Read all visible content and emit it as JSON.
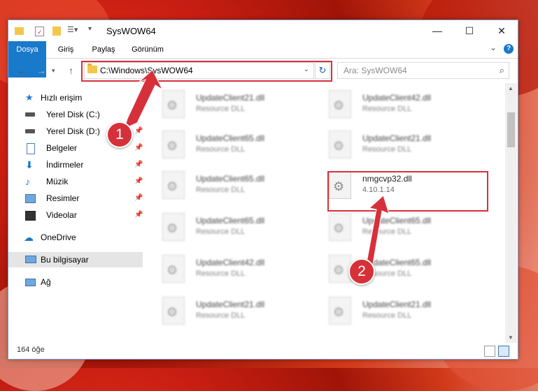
{
  "window": {
    "title": "SysWOW64",
    "controls": {
      "minimize": "—",
      "maximize": "☐",
      "close": "✕"
    }
  },
  "ribbon": {
    "tabs": [
      "Dosya",
      "Giriş",
      "Paylaş",
      "Görünüm"
    ],
    "help": "?",
    "expand": "⌄"
  },
  "address": {
    "path": "C:\\Windows\\SysWOW64",
    "search_placeholder": "Ara: SysWOW64"
  },
  "sidebar": {
    "quick_access": "Hızlı erişim",
    "items": [
      {
        "label": "Yerel Disk (C:)",
        "icon": "drive-icon"
      },
      {
        "label": "Yerel Disk (D:)",
        "icon": "drive-icon"
      },
      {
        "label": "Belgeler",
        "icon": "documents-icon"
      },
      {
        "label": "İndirmeler",
        "icon": "downloads-icon"
      },
      {
        "label": "Müzik",
        "icon": "music-icon"
      },
      {
        "label": "Resimler",
        "icon": "pictures-icon"
      },
      {
        "label": "Videolar",
        "icon": "videos-icon"
      }
    ],
    "onedrive": "OneDrive",
    "this_pc": "Bu bilgisayar",
    "network": "Ağ"
  },
  "files": {
    "left": [
      {
        "name": "UpdateClient21.dll",
        "sub": "Resource DLL"
      },
      {
        "name": "UpdateClient65.dll",
        "sub": "Resource DLL"
      },
      {
        "name": "UpdateClient65.dll",
        "sub": "Resource DLL"
      },
      {
        "name": "UpdateClient65.dll",
        "sub": "Resource DLL"
      },
      {
        "name": "UpdateClient42.dll",
        "sub": "Resource DLL"
      },
      {
        "name": "UpdateClient21.dll",
        "sub": "Resource DLL"
      }
    ],
    "right": [
      {
        "name": "UpdateClient42.dll",
        "sub": "Resource DLL"
      },
      {
        "name": "UpdateClient21.dll",
        "sub": "Resource DLL"
      },
      {
        "name": "nmgcvp32.dll",
        "sub": "4.10.1.14"
      },
      {
        "name": "UpdateClient65.dll",
        "sub": "Resource DLL"
      },
      {
        "name": "UpdateClient65.dll",
        "sub": "Resource DLL"
      },
      {
        "name": "UpdateClient21.dll",
        "sub": "Resource DLL"
      }
    ]
  },
  "status": {
    "count": "164 öğe"
  },
  "annotations": {
    "marker1": "1",
    "marker2": "2"
  },
  "colors": {
    "accent": "#1979ca",
    "highlight": "#d6313a"
  }
}
